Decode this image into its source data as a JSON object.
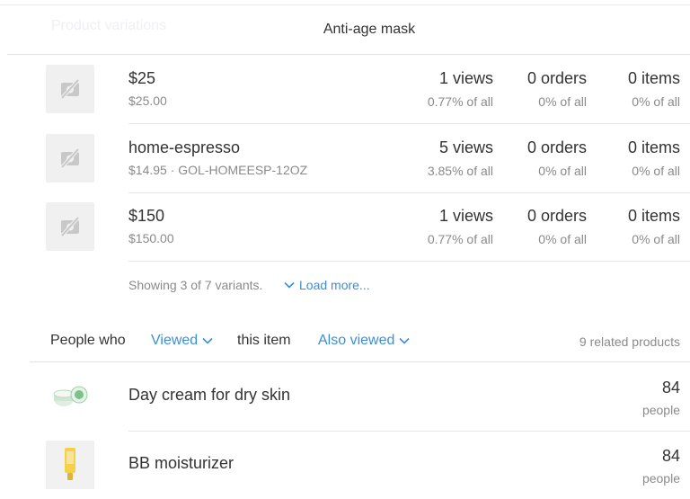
{
  "header": {
    "ghost_title": "Product variations",
    "title": "Anti-age mask"
  },
  "variants": [
    {
      "name": "$25",
      "sub": "$25.00",
      "views": "1 views",
      "views_pct": "0.77% of all",
      "orders": "0 orders",
      "orders_pct": "0% of all",
      "items": "0 items",
      "items_pct": "0% of all",
      "icon": "no-image-icon"
    },
    {
      "name": "home-espresso",
      "sub": "$14.95 · GOL-HOMEESP-12OZ",
      "views": "5 views",
      "views_pct": "3.85% of all",
      "orders": "0 orders",
      "orders_pct": "0% of all",
      "items": "0 items",
      "items_pct": "0% of all",
      "icon": "no-image-icon"
    },
    {
      "name": "$150",
      "sub": "$150.00",
      "views": "1 views",
      "views_pct": "0.77% of all",
      "orders": "0 orders",
      "orders_pct": "0% of all",
      "items": "0 items",
      "items_pct": "0% of all",
      "icon": "no-image-icon"
    }
  ],
  "pagination": {
    "showing": "Showing 3 of 7 variants.",
    "load_more": "Load more..."
  },
  "people": {
    "prefix": "People who",
    "action_dropdown": "Viewed",
    "middle": "this item",
    "relation_dropdown": "Also viewed",
    "related_count": "9 related products"
  },
  "products": [
    {
      "name": "Day cream for dry skin",
      "count": "84",
      "unit": "people",
      "icon": "cream-jar-icon"
    },
    {
      "name": "BB moisturizer",
      "count": "84",
      "unit": "people",
      "icon": "cream-tube-icon"
    }
  ],
  "colors": {
    "accent": "#3d8ed8",
    "muted_text": "#8a8a8a",
    "placeholder_bg": "#f0f0f0"
  }
}
